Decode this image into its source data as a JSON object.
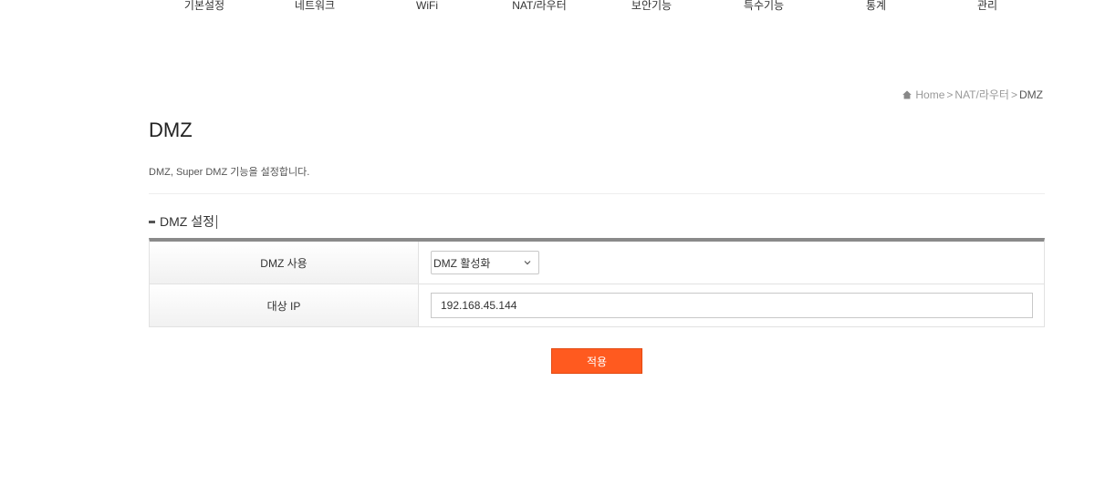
{
  "nav": {
    "items": [
      {
        "label": "기본설정"
      },
      {
        "label": "네트워크"
      },
      {
        "label": "WiFi"
      },
      {
        "label": "NAT/라우터"
      },
      {
        "label": "보안기능"
      },
      {
        "label": "특수기능"
      },
      {
        "label": "통계"
      },
      {
        "label": "관리"
      }
    ]
  },
  "breadcrumb": {
    "home": "Home",
    "separator": ">",
    "section": "NAT/라우터",
    "current": "DMZ"
  },
  "page": {
    "title": "DMZ",
    "description": "DMZ, Super DMZ 기능을 설정합니다."
  },
  "section": {
    "title": "DMZ 설정"
  },
  "form": {
    "dmz_use_label": "DMZ 사용",
    "dmz_use_value": "DMZ 활성화",
    "target_ip_label": "대상 IP",
    "target_ip_value": "192.168.45.144"
  },
  "actions": {
    "apply_label": "적용"
  },
  "colors": {
    "apply_button": "#ff5a1f",
    "table_top_border": "#8a8a8a"
  },
  "icons": {
    "breadcrumb_home": "home-icon",
    "select_arrow": "chevron-down-icon"
  }
}
